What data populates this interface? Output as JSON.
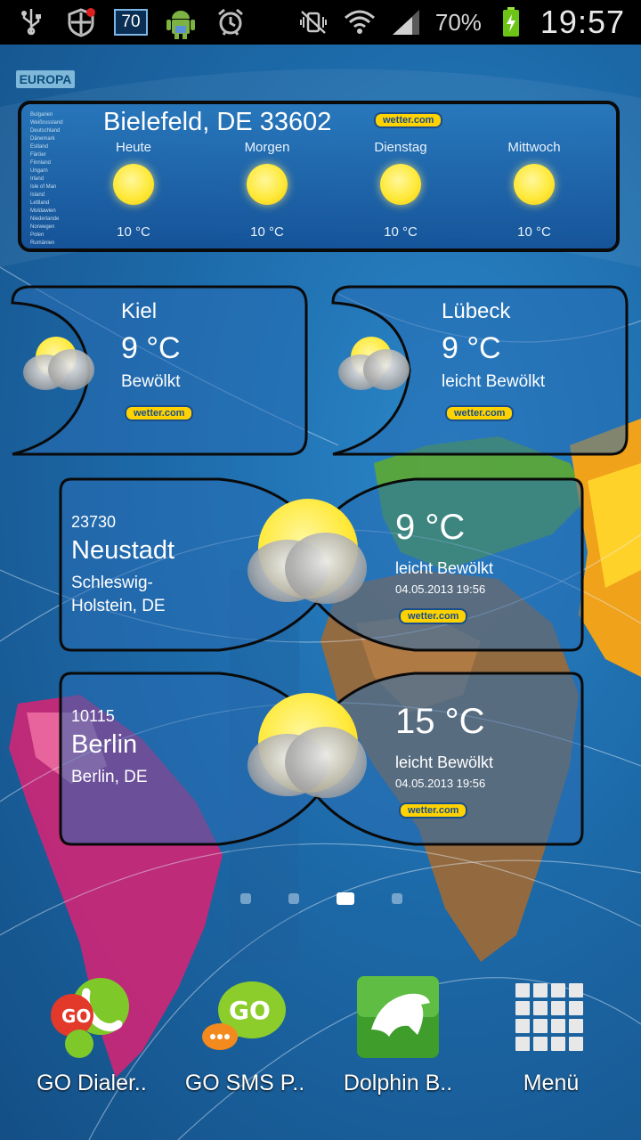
{
  "status_bar": {
    "battery_percent": "70%",
    "time": "19:57",
    "notification_badge": "70"
  },
  "wallpaper": {
    "region_tag": "EUROPA"
  },
  "big_widget": {
    "title": "Bielefeld, DE 33602",
    "logo": "wetter.com",
    "countries": [
      "Bulgarien",
      "Weißrussland",
      "Deutschland",
      "Dänemark",
      "Estland",
      "Färöer",
      "Finnland",
      "Ungarn",
      "Irland",
      "Isle of Man",
      "Island",
      "Lettland",
      "Moldawien",
      "Niederlande",
      "Norwegen",
      "Polen",
      "Rumänien"
    ],
    "forecast": [
      {
        "day": "Heute",
        "temp": "10 °C"
      },
      {
        "day": "Morgen",
        "temp": "10 °C"
      },
      {
        "day": "Dienstag",
        "temp": "10 °C"
      },
      {
        "day": "Mittwoch",
        "temp": "10 °C"
      }
    ]
  },
  "small_widgets": [
    {
      "city": "Kiel",
      "temp": "9 °C",
      "desc": "Bewölkt",
      "logo": "wetter.com"
    },
    {
      "city": "Lübeck",
      "temp": "9 °C",
      "desc": "leicht Bewölkt",
      "logo": "wetter.com"
    }
  ],
  "city_widgets": [
    {
      "zip": "23730",
      "city": "Neustadt",
      "region": "Schleswig-Holstein, DE",
      "temp": "9 °C",
      "desc": "leicht Bewölkt",
      "date": "04.05.2013 19:56",
      "logo": "wetter.com"
    },
    {
      "zip": "10115",
      "city": "Berlin",
      "region": "Berlin, DE",
      "temp": "15 °C",
      "desc": "leicht Bewölkt",
      "date": "04.05.2013 19:56",
      "logo": "wetter.com"
    }
  ],
  "page_indicator": {
    "count": 4,
    "active_index": 2
  },
  "dock": {
    "apps": [
      {
        "label": "GO Dialer..",
        "icon": "go-dialer-icon"
      },
      {
        "label": "GO SMS P..",
        "icon": "go-sms-icon"
      },
      {
        "label": "Dolphin B..",
        "icon": "dolphin-browser-icon"
      },
      {
        "label": "Menü",
        "icon": "app-drawer-icon"
      }
    ]
  },
  "colors": {
    "logo_yellow": "#ffd200",
    "logo_blue": "#1a4e8a",
    "background_blue": "#1e6fb0"
  }
}
